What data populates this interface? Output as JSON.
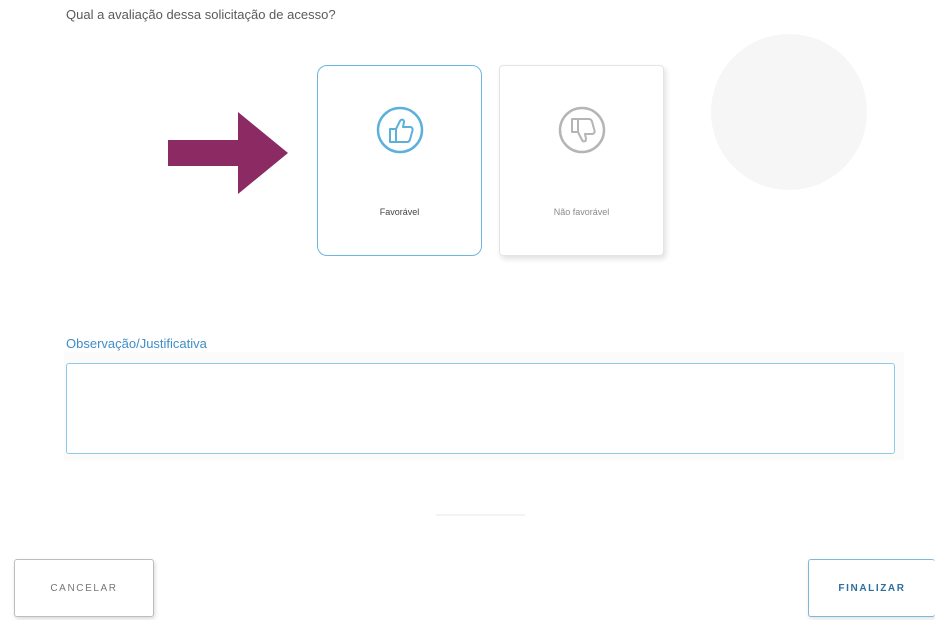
{
  "question": "Qual a avaliação dessa solicitação de acesso?",
  "options": {
    "favorable": {
      "label": "Favorável",
      "icon": "thumbs-up-icon",
      "selected": true
    },
    "unfavorable": {
      "label": "Não favorável",
      "icon": "thumbs-down-icon",
      "selected": false
    }
  },
  "observation": {
    "label": "Observação/Justificativa",
    "value": ""
  },
  "buttons": {
    "cancel": "CANCELAR",
    "finish": "FINALIZAR"
  },
  "annotation": {
    "icon": "arrow-right-icon",
    "color": "#8b2a63"
  },
  "colors": {
    "accent": "#5bb0dc",
    "label_blue": "#3f8ec6",
    "muted": "#b5b5b5"
  }
}
